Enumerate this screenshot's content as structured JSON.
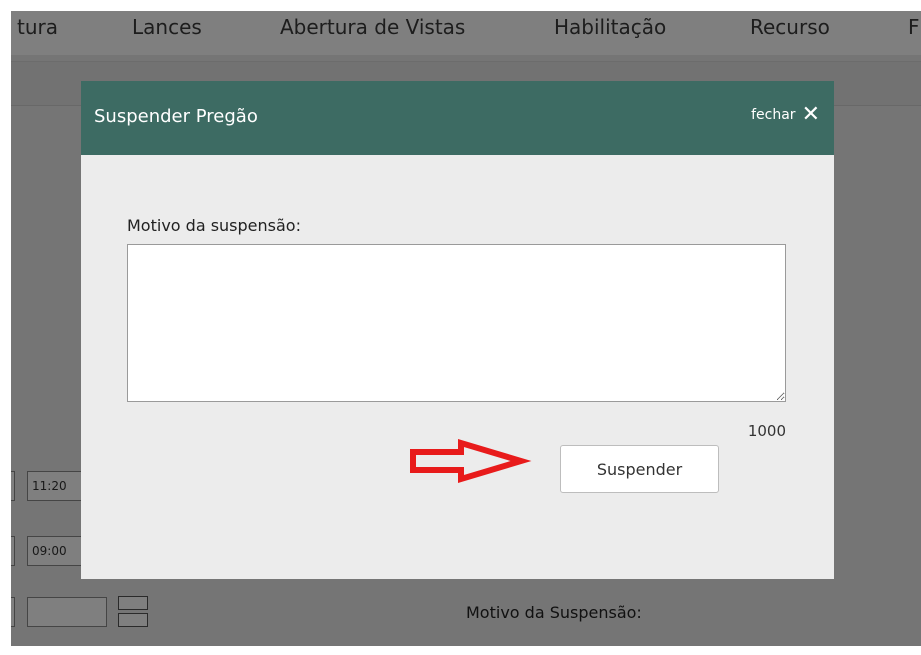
{
  "background": {
    "tabs": [
      "tura",
      "Lances",
      "Abertura de Vistas",
      "Habilitação",
      "Recurso",
      "F"
    ],
    "times": [
      "11:20",
      "09:00"
    ],
    "suspension_reason_label": "Motivo da Suspensão:"
  },
  "modal": {
    "title": "Suspender Pregão",
    "close_label": "fechar",
    "close_icon": "close-icon",
    "reason_label": "Motivo da suspensão:",
    "reason_value": "",
    "char_counter": "1000",
    "submit_label": "Suspender"
  },
  "annotation": {
    "arrow_color": "#e81b1b"
  },
  "colors": {
    "header": "#3d6b63",
    "modal_body": "#ececec"
  }
}
